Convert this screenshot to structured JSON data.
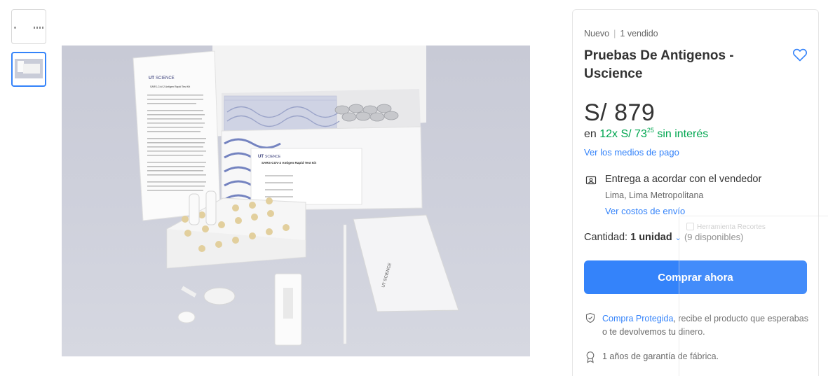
{
  "gallery": {
    "thumbnails": [
      {
        "name": "thumbnail-1",
        "active": false
      },
      {
        "name": "thumbnail-2",
        "active": true
      }
    ],
    "photo_text": {
      "brand": "SCIENCE",
      "kit_title": "SARS-COV-2 Antigen Rapid Test Kit",
      "leaflet_title": "SARS-CoV-2 Antigen Rapid Test Kit"
    }
  },
  "product": {
    "condition": "Nuevo",
    "sold": "1 vendido",
    "title": "Pruebas De Antigenos - Uscience",
    "price": "S/ 879",
    "installments_prefix": "en",
    "installments_amount": "12x S/ 73",
    "installments_cents": "25",
    "installments_suffix": "sin interés",
    "payment_link": "Ver los medios de pago"
  },
  "delivery": {
    "title": "Entrega a acordar con el vendedor",
    "location": "Lima, Lima Metropolitana",
    "shipping_link": "Ver costos de envío"
  },
  "quantity": {
    "label": "Cantidad:",
    "value": "1 unidad",
    "available": "(9 disponibles)"
  },
  "buy_button": "Comprar ahora",
  "protection": {
    "link": "Compra Protegida",
    "text": ", recibe el producto que esperabas o te devolvemos tu dinero."
  },
  "warranty": "1 años de garantía de fábrica.",
  "overlay": {
    "label": "Herramienta Recortes"
  },
  "colors": {
    "accent": "#3483fa",
    "green": "#00a650"
  },
  "icons": [
    "heart-icon",
    "delivery-icon",
    "chevron-down-icon",
    "shield-check-icon",
    "medal-icon"
  ]
}
